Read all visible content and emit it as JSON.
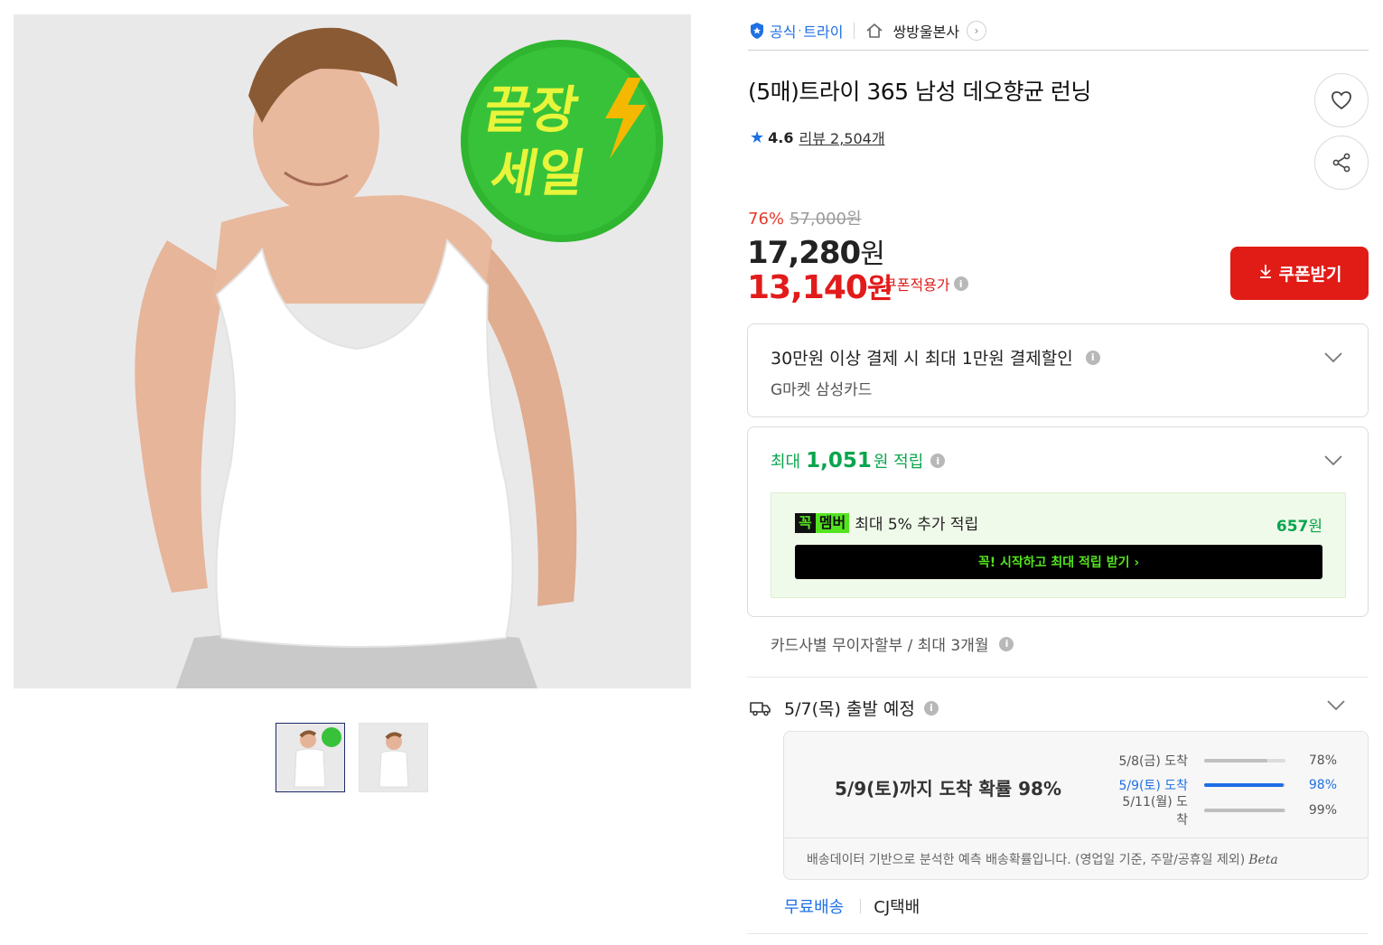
{
  "store": {
    "official_label": "공식",
    "separator": "·",
    "brand_name": "트라이",
    "seller_name": "쌍방울본사"
  },
  "product": {
    "title": "(5매)트라이 365 남성 데오향균 런닝",
    "image_badge": "끝장 세일",
    "rating": "4.6",
    "review_label": "리뷰 2,504개"
  },
  "price": {
    "discount_rate": "76%",
    "original": "57,000원",
    "sale": "17,280",
    "sale_unit": "원",
    "coupon_price": "13,140",
    "coupon_unit": "원",
    "coupon_note": "쿠폰적용가",
    "coupon_button": "쿠폰받기"
  },
  "payment_benefit": {
    "title": "30만원 이상 결제 시 최대 1만원 결제할인",
    "subtitle": "G마켓 삼성카드"
  },
  "points": {
    "prefix": "최대",
    "amount": "1,051",
    "suffix": "원 적립",
    "member_logo_1": "꼭",
    "member_logo_2": "멤버",
    "member_text": "최대 5% 추가 적립",
    "member_amount": "657",
    "member_unit": "원",
    "member_cta": "꼭! 시작하고 최대 적립 받기  ›"
  },
  "installment": "카드사별 무이자할부 / 최대 3개월",
  "shipping": {
    "departure": "5/7(목) 출발 예정",
    "prediction_main": "5/9(토)까지 도착 확률 98%",
    "rows": [
      {
        "date": "5/8(금) 도착",
        "pct": "78%",
        "value": 0.78
      },
      {
        "date": "5/9(토) 도착",
        "pct": "98%",
        "value": 0.98
      },
      {
        "date": "5/11(월) 도착",
        "pct": "99%",
        "value": 0.99
      }
    ],
    "footnote": "배송데이터 기반으로 분석한 예측 배송확률입니다. (영업일 기준, 주말/공휴일 제외)",
    "beta": "Beta",
    "fee": "무료배송",
    "courier": "CJ택배"
  },
  "colors": {
    "accent_blue": "#1f6fe5",
    "sale_red": "#e21b1b",
    "point_green": "#0aa54d",
    "member_green": "#54e41f"
  }
}
